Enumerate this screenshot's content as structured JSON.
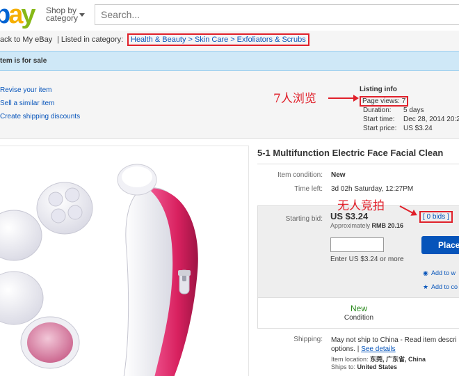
{
  "header": {
    "logo_e": "e",
    "logo_b": "b",
    "logo_a": "a",
    "logo_y": "y",
    "shop_by_line1": "Shop by",
    "shop_by_line2": "category",
    "search_placeholder": "Search..."
  },
  "crumbrow": {
    "back_link": "ack to My eBay",
    "listed_in": "| Listed in category:",
    "categories": [
      "Health & Beauty",
      "Skin Care",
      "Exfoliators & Scrubs"
    ],
    "separator": ">"
  },
  "banner": {
    "text": "tem is for sale"
  },
  "seller_tools": {
    "links": [
      "Revise your item",
      "Sell a similar item",
      "Create shipping discounts"
    ]
  },
  "annotations": {
    "views": "7人浏览",
    "no_bids": "无人竞拍"
  },
  "listing_info": {
    "title": "Listing info",
    "page_views_label": "Page views:",
    "page_views_value": "7",
    "rows": [
      {
        "label": "Duration:",
        "value": "5 days"
      },
      {
        "label": "Start time:",
        "value": "Dec 28, 2014 20:2"
      },
      {
        "label": "Start price:",
        "value": "US $3.24"
      }
    ]
  },
  "item": {
    "title": "5-1 Multifunction Electric Face Facial Clean",
    "condition_label": "Item condition:",
    "condition_value": "New",
    "time_left_label": "Time left:",
    "time_left_value": "3d 02h Saturday, 12:27PM",
    "starting_bid_label": "Starting bid:",
    "price": "US $3.24",
    "approx_label": "Approximately",
    "approx_value": "RMB 20.16",
    "bids": "[ 0 bids ]",
    "enter_hint": "Enter US $3.24 or more",
    "place_bid": "Place bid",
    "watch_list": "Add to w",
    "collection": "Add to co",
    "condition_box_value": "New",
    "condition_box_label": "Condition",
    "shipping_label": "Shipping:",
    "shipping_text": "May not ship to China - Read item descri options.",
    "see_details": "See details",
    "item_location_label": "Item location:",
    "item_location_value": "东莞, 广东省, China",
    "ships_to_label": "Ships to:",
    "ships_to_value": "United States"
  },
  "colors": {
    "ebay_red": "#e53238",
    "ebay_blue": "#0064d2",
    "ebay_yellow": "#f5af02",
    "ebay_green": "#86b817",
    "annotation_red": "#e0202a",
    "link_blue": "#0654ba",
    "banner_blue": "#cfe8f7"
  }
}
